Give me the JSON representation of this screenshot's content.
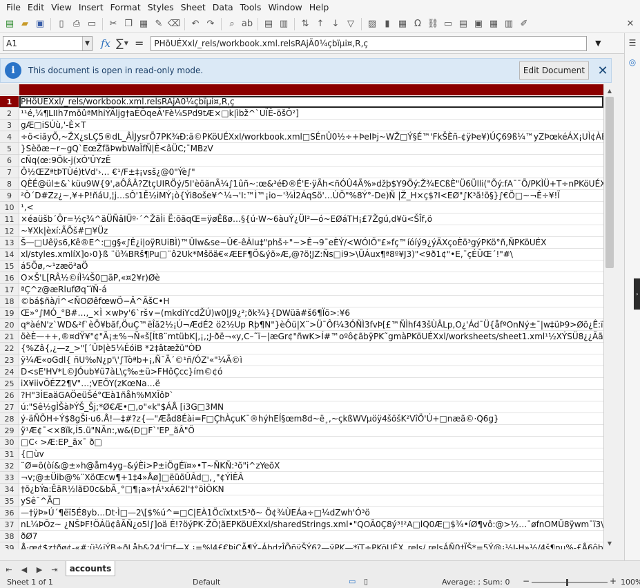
{
  "menu": [
    "File",
    "Edit",
    "View",
    "Insert",
    "Format",
    "Styles",
    "Sheet",
    "Data",
    "Tools",
    "Window",
    "Help"
  ],
  "formula_bar": {
    "name_box": "A1",
    "content": "PHöUÉXxl/_rels/workbook.xml.relsRAjÃ0¼çbïµi¤,R,ç"
  },
  "infobar": {
    "message": "This document is open in read-only mode.",
    "edit_button": "Edit Document"
  },
  "rows": [
    {
      "num": "1",
      "text": "PHöUÉXxl/_rels/workbook.xml.relsRAjÃ0¼çbïµi¤,R,ç"
    },
    {
      "num": "2",
      "text": "¹¹é,¼¶LIIh7möûªMhiÝÄljg†aÈÕqeÂ'Fè¼SPd9tÆ×□k|ìbž^`UÏÊ-öšÔ²]"
    },
    {
      "num": "3",
      "text": "gÆ□iSÚù,'-È×T"
    },
    {
      "num": "4",
      "text": "÷ö<iãyÕ,~ŽX¿sLÇ5®dL_ÂÌJysrÕ7PK¾Ð:ä©PKöUÉXxl/workbook.xml□SÉnÛ0½÷+ÞeIÞj~WŽ□Ý§É™'FkŠÈñ-¢ÿÞe¥)ÚÇ69ß¼™yZÞœkéÁX¡UÌ¢ÀÈ"
    },
    {
      "num": "5",
      "text": "}Sèöæ~r~gQ`EœŽfãÞwbWaÏfÑ|È<âÜC;¯MBzV"
    },
    {
      "num": "6",
      "text": "cÑq(œ:9Õk-j(xÓ'ÛYzÊ"
    },
    {
      "num": "7",
      "text": "Ô½ŒZªtÞTÙé)tVd'›… €¹/F±‡¡vsš¿@0\"Ýè∫\""
    },
    {
      "num": "8",
      "text": "QÈÉ@ül±&`küu9W{9',aÔÂÂ?ZtçUIRÖý/5I'èöãnÃ¼∫1ûñ~:œ&³éÐ®É'E·ÿÃh<ñÓÛ4Ã%»džþ$Y9Öý:Ž¾ECßÈ\"Ü6Ülli(\"Õý:fA¯¯Õ/PKÌÜ+T÷nPKöUÉXx"
    },
    {
      "num": "9",
      "text": "²Ò´D#Zz¿~,¥+P!ñáU,¦j…sÔ'1Ë½iMÝ¡ò{Ýi8oše¥^¼¬'I:™Ì™¡io~'¾Ì2ÁqSö'…ÙÕ\"%8Ý°-De)Ñ |Ž_H×ç$?I<EØ\"∫K³ã!ö§}∫€Ö□~¬Ê÷¥!Ï"
    },
    {
      "num": "10",
      "text": "¹,<"
    },
    {
      "num": "11",
      "text": "×éaüšb´Ôr=½ç¾^äÜÑâIÜº·´^ŽãÌi Ë:õãqŒ=ÿøÊßø…§{ú·W~6àuÝ¿Ül²—ó~EØáTH¡£7Žgú,d¥ü<ŠÎf,ö"
    },
    {
      "num": "12",
      "text": "~¥Xk|èxí:ÃÕš#□¥Üz"
    },
    {
      "num": "13",
      "text": "Š—□Uêÿs6,Kê®E^:□g§«∫Ê¿i|oÿRUiBÌ)™Ûlw&se~Û€-êÂlu‡\"phš÷\"~>Ê¬9¯eÈÝ/<WÓIÕ\"£»fç™íóíý9¿ýÄXçoÈö³gýPKö°ñ,ÑPKöUÉX"
    },
    {
      "num": "14",
      "text": "xl/styles.xmlíX]o›0}ß ¨ü¾BRš¶Pu□¨ô2Uk*Mšöä€«ÆEF¶Ö&ýõ»Æ,@?ö¦JZ:Ñs□i9>\\ÛÁux¶ª8º¥J3)\"<9ð1¢\"•E,¯çÉÜŒ´!\"#\\"
    },
    {
      "num": "15",
      "text": "á5Õø,~¹zæö³aÖ"
    },
    {
      "num": "16",
      "text": "O×Š'L[RÂ½©íÌ¼Š0□ãP,«¤2¥r)Øè"
    },
    {
      "num": "17",
      "text": "ªÇ^z@æRlufØq¨ïÑ-á"
    },
    {
      "num": "18",
      "text": "©bá$ñà/Ì^<ÑOØêfœwÖ−Â^ÃšC•H"
    },
    {
      "num": "19",
      "text": "Œ»°∫MÓ_°B#…,_×Ì ×wÞy'6`rš∨−(mkdiYcdŽÚ)w0|J9¿²;ðk¾}{DWüã#š6¶Ïõ>:¥6"
    },
    {
      "num": "20",
      "text": "q*àéN'z`WD&²f`èÖ¥bãf,ÖuÇ™ëÎã2½¡Ú¬ÆdÉ2 ö2½Up Rþ¶N\"}èÔü|X¨>Ü¯Ôf¼3ÓÑÌ3fvÞ[£™ÑÌhf43šÙÂLp,O¿'Ád¯Ü{åfºOnNý±¯|w‡üÞ9>Øõ¿Ê:ïüy¡õ"
    },
    {
      "num": "21",
      "text": "öèÈ—++,®¤dŸ¥\"¢\"Ä¡±%¬Ñ«š[Ít8¨mtübK|,¡,;J-ðë¬«y,C–˜ï−|æGr¢\"ñwK>Í#™oºô¢ãbÿPK˜gmàPKöUÉXxl/worksheets/sheet1.xml¹½XÝSÜ8¿¿Ãã‡>]ãû"
    },
    {
      "num": "22",
      "text": "{%Zâ{,¿—z_>\"[´ÛÞ|è5¼ÉóiB *2‡âtæžü\"ÒÐ"
    },
    {
      "num": "23",
      "text": "ÿ¼Æ«oGdl{     ñU‰N¿p'\\'∫Tòªb+¡,Ñ¯Ä´©¹ñ/ÓZ'«\"¼Ã©ì"
    },
    {
      "num": "24",
      "text": "D<sE'HV*L©JÓub¥ü7àL\\ç‰±ü>FHôÇcc}ím©¢ó"
    },
    {
      "num": "25",
      "text": "iX¥iivÕÉZ2¶V\"…;VEÖY(zKœNa…ë"
    },
    {
      "num": "26",
      "text": "?H\"3ÌEaäGAÖeüŠé°Œà1ñåh%MXÎôÞ`"
    },
    {
      "num": "27",
      "text": "ú:\"Sê½gÌŠàÞÝŠ_Šj;*Ø€Æ•□,o\"«k\"$ÁÅ [i3G□3MN"
    },
    {
      "num": "28",
      "text": "ý-äÑÕH÷Ý$8gŠi·u6.Å!—‡#?z{—\"Æåd8Éài=F□ÇhÀçuK¯®hýhEÍ§œm8d~ë¸,~çkßWVµöÿ4šöšK²VîÖ'Ú+□næã©·Q6g}"
    },
    {
      "num": "29",
      "text": "ÿ¹Æ¢¯<×8ïk,Í5.ü\"NÃn:,w&(Ð□F`'EP_ãÂ\"Ö"
    },
    {
      "num": "30",
      "text": "□C‹ >Æ:EP_ãx¯ ð□"
    },
    {
      "num": "31",
      "text": "{□ùv"
    },
    {
      "num": "32",
      "text": "¨Ø=õ(òí&@±»h@åm4yg–&ýÈi>P±iÖgÉï¤»•T~ÑKÑ:³õ\"i^zYeõX"
    },
    {
      "num": "33",
      "text": "¬v;@±Üib@%¨XöŒcw¶+1‡4»Åø]□ëüöÛÂd□,¸\"¢ÝÌÊÂ"
    },
    {
      "num": "34",
      "text": "†õ¿bÝa:ÊäR½lãÐ0c&bÃ¸°□¶¡a»†Á¹xÁ62l'†°öÌÒKN"
    },
    {
      "num": "35",
      "text": "ySê¯^Ä□"
    },
    {
      "num": "36",
      "text": "—†ÿÞ»Ú´¶ëï5É8yb…Dt·Ì□—2\\[$%ú^=□C|EÀ1Öcïxtxt5³ð~    Ö¢¾ÙEÁa÷□¼dZwh'Ó³ö"
    },
    {
      "num": "37",
      "text": "nL¼ÞÕz~ ¿NŠÞF!ÖÁü¢âÃÑ¿o5l∫]oä É!?öýPK·ŽÕ¦ãEPKöUÉXxl/sharedStrings.xml•\"QOÃ0Ç8ý³!²A□lQ0Æ□$¾•íØ¶vô:@>½…¯øfnOMÜ8ÿwm¯ï3\\ì0"
    },
    {
      "num": "38",
      "text": "ðØ7"
    },
    {
      "num": "39",
      "text": "Å·œ¢$z†ðø¢-«#:ü¼iÝB÷ðLåþ&24'Í□f—X,¡=%l4£€ÞiÇÃ¶Ý–ÁbdzÎÕñÿŠÝ6?—ÿPK—*ïT÷PKöUÉX_rels/.relsÁÑ0†ÏŠ*=5Ý@¡½J-H»½/4š¶nu%-£Å6ôb"
    }
  ],
  "sheet_tab": "accounts",
  "status": {
    "sheet": "Sheet 1 of 1",
    "style": "Default",
    "summary": "Average: ; Sum: 0",
    "zoom": "100%"
  },
  "icons": {
    "info": "i",
    "close": "✕",
    "fx": "fx",
    "sigma": "∑",
    "equals": "="
  }
}
